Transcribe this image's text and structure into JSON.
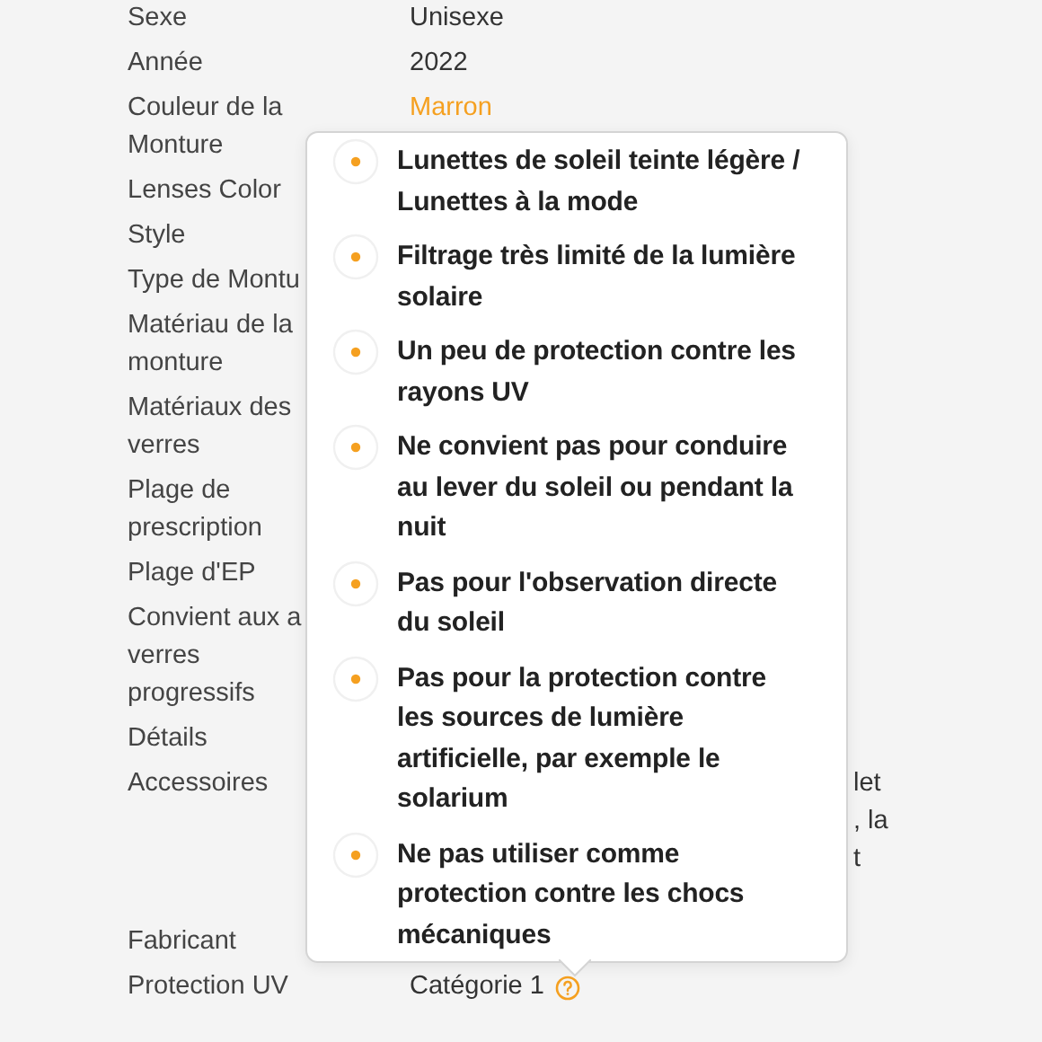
{
  "specs": [
    {
      "label": "Sexe",
      "kind": "text",
      "value": "Unisexe"
    },
    {
      "label": "Année",
      "kind": "text",
      "value": "2022"
    },
    {
      "label": "Couleur de la Monture",
      "kind": "accent",
      "value": "Marron"
    },
    {
      "label": "Lenses Color",
      "kind": "text"
    },
    {
      "label": "Style",
      "kind": "text"
    },
    {
      "label": "Type de Montu",
      "kind": "text"
    },
    {
      "label": "Matériau de la monture",
      "kind": "text"
    },
    {
      "label": "Matériaux des verres",
      "kind": "text"
    },
    {
      "label": "Plage de prescription",
      "kind": "text"
    },
    {
      "label": "Plage d'EP",
      "kind": "text"
    },
    {
      "label": "Convient aux a verres progressifs",
      "kind": "text"
    },
    {
      "label": "Détails",
      "kind": "text"
    },
    {
      "label": "Accessoires",
      "kind": "lines",
      "lines": [
        "let",
        ", la",
        "t"
      ]
    },
    {
      "label": "Fabricant",
      "kind": "text"
    },
    {
      "label": "Protection UV",
      "kind": "info",
      "value": "Catégorie 1"
    }
  ],
  "popover": {
    "items": [
      "Lunettes de soleil teinte légère / Lunettes à la mode",
      "Filtrage très limité de la lumière solaire",
      "Un peu de protection contre les rayons UV",
      "Ne convient pas pour conduire au lever du soleil ou pendant la nuit",
      "Pas pour l'observation directe du soleil",
      "Pas pour la protection contre les sources de lumière artificielle, par exemple le solarium",
      "Ne pas utiliser comme protection contre les chocs mécaniques"
    ]
  }
}
